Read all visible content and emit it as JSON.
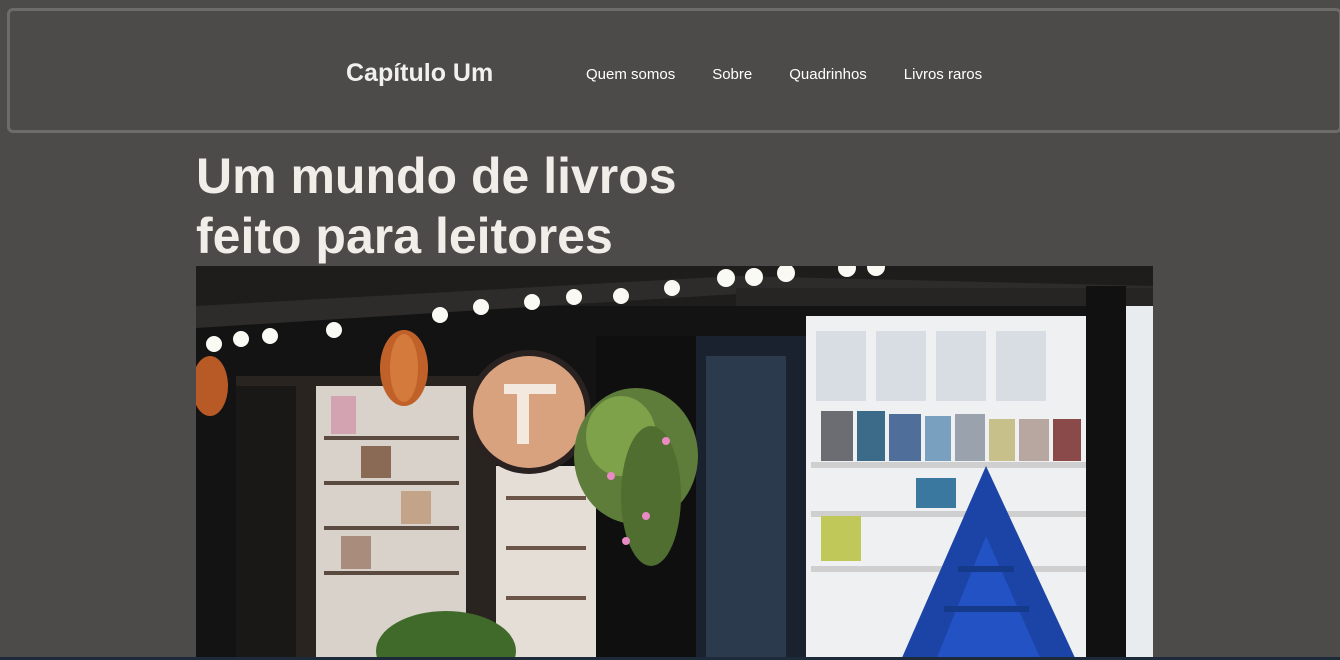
{
  "header": {
    "brand": "Capítulo Um",
    "nav": [
      {
        "label": "Quem somos"
      },
      {
        "label": "Sobre"
      },
      {
        "label": "Quadrinhos"
      },
      {
        "label": "Livros raros"
      }
    ]
  },
  "hero": {
    "title_line1": "Um mundo de livros",
    "title_line2": "feito para leitores"
  }
}
